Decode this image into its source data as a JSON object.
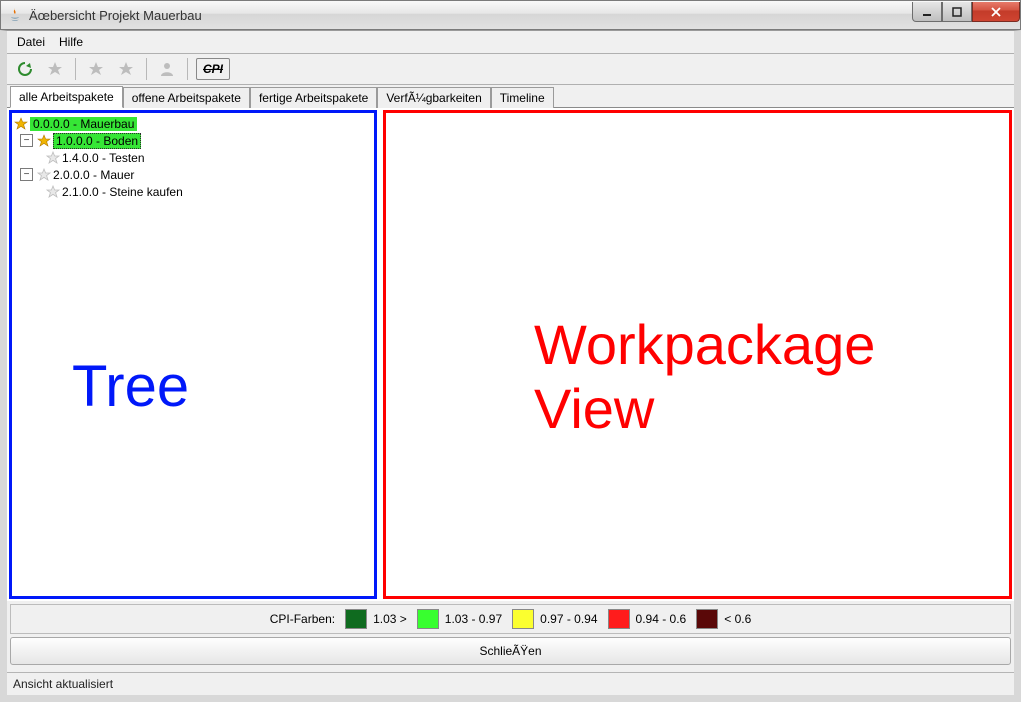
{
  "window": {
    "title": "Äœbersicht Projekt Mauerbau"
  },
  "menubar": {
    "file": "Datei",
    "help": "Hilfe"
  },
  "toolbar": {
    "cpi_label": "CPI"
  },
  "tabs": {
    "items": [
      "alle Arbeitspakete",
      "offene Arbeitspakete",
      "fertige Arbeitspakete",
      "VerfÃ¼gbarkeiten",
      "Timeline"
    ]
  },
  "tree": {
    "label": "Tree",
    "nodes": {
      "n0": "0.0.0.0 - Mauerbau",
      "n1": "1.0.0.0 - Boden",
      "n2": "1.4.0.0 - Testen",
      "n3": "2.0.0.0 - Mauer",
      "n4": "2.1.0.0 - Steine kaufen"
    }
  },
  "view": {
    "label_line1": "Workpackage",
    "label_line2": "View"
  },
  "legend": {
    "title": "CPI-Farben:",
    "items": [
      {
        "color": "#0f6b1f",
        "label": "1.03 >"
      },
      {
        "color": "#38ff2f",
        "label": "1.03 - 0.97"
      },
      {
        "color": "#fbff2f",
        "label": "0.97 - 0.94"
      },
      {
        "color": "#ff1c1c",
        "label": "0.94 - 0.6"
      },
      {
        "color": "#5a0808",
        "label": "< 0.6"
      }
    ]
  },
  "close_button": "SchlieÃŸen",
  "status": "Ansicht aktualisiert"
}
